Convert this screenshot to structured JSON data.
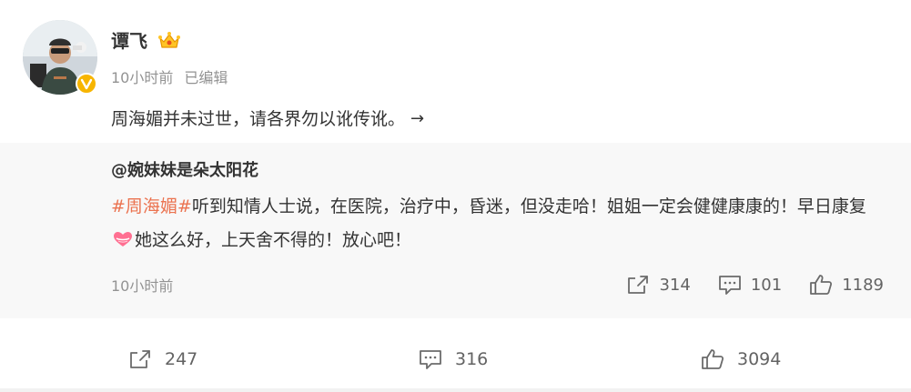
{
  "post": {
    "author": "谭飞",
    "time": "10小时前",
    "edited": "已编辑",
    "text": "周海媚并未过世，请各界勿以讹传讹。",
    "more_arrow": "→",
    "icons": {
      "avatar": "user-avatar",
      "verified": "verified-badge-icon",
      "vip": "crown-vip-icon"
    }
  },
  "retweet": {
    "author": "@婉妹妹是朵太阳花",
    "hashtag": "#周海媚#",
    "text_part1": "听到知情人士说，在医院，治疗中，昏迷，但没走哈！姐姐一定会健健康康的！早日康复",
    "text_part2": "她这么好，上天舍不得的！放心吧！",
    "emoji": "heart-emoji-icon",
    "time": "10小时前",
    "forwards": "314",
    "comments": "101",
    "likes": "1189"
  },
  "toolbar": {
    "forwards": "247",
    "comments": "316",
    "likes": "3094"
  },
  "colors": {
    "hashtag": "#eb7350",
    "retweet_bg": "#f8f8f8",
    "verified": "#f7b500",
    "meta_text": "#939393"
  }
}
